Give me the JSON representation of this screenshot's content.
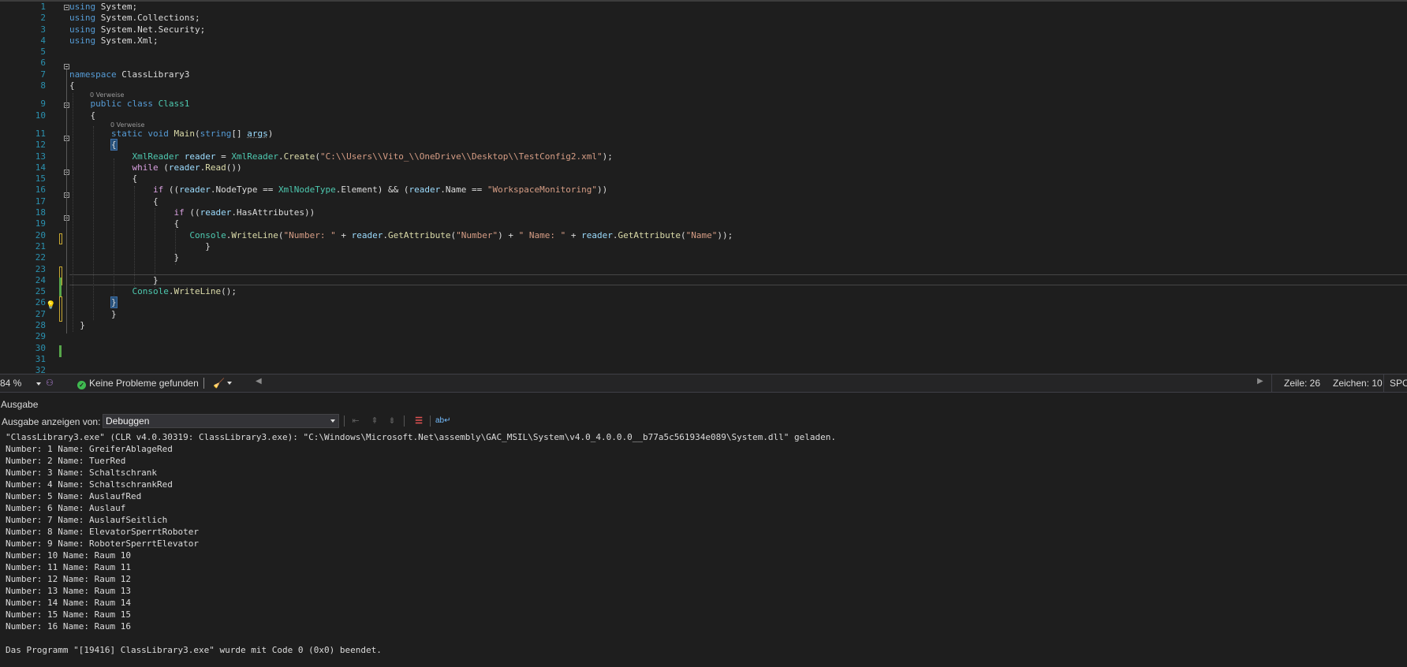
{
  "editor": {
    "line_numbers": [
      "1",
      "2",
      "3",
      "4",
      "5",
      "6",
      "7",
      "8",
      "9",
      "10",
      "11",
      "12",
      "13",
      "14",
      "15",
      "16",
      "17",
      "18",
      "19",
      "20",
      "21",
      "22",
      "23",
      "24",
      "25",
      "26",
      "27",
      "28",
      "29",
      "30",
      "31",
      "32"
    ],
    "references_label": "0 Verweise",
    "lines": {
      "l1_kw": "using",
      "l1_rest": " System;",
      "l2_kw": "using",
      "l2_rest": " System.Collections;",
      "l3_kw": "using",
      "l3_rest": " System.Net.Security;",
      "l4_kw": "using",
      "l4_rest": " System.Xml;",
      "l7_kw": "namespace",
      "l7_rest": " ClassLibrary3",
      "l8": "{",
      "l9_kw1": "public",
      "l9_kw2": "class",
      "l9_name": "Class1",
      "l10": "{",
      "l11_kw1": "static",
      "l11_kw2": "void",
      "l11_fn": "Main",
      "l11_p1": "(",
      "l11_kw3": "string",
      "l11_p2": "[] ",
      "l11_arg": "args",
      "l11_p3": ")",
      "l12": "{",
      "l13_ty": "XmlReader",
      "l13_var": "reader",
      "l13_eq": " = ",
      "l13_ty2": "XmlReader",
      "l13_dot": ".",
      "l13_fn": "Create",
      "l13_p1": "(",
      "l13_str": "\"C:\\\\Users\\\\Vito_\\\\OneDrive\\\\Desktop\\\\TestConfig2.xml\"",
      "l13_p2": ");",
      "l14_kw": "while",
      "l14_p1": " (",
      "l14_var": "reader",
      "l14_dot": ".",
      "l14_fn": "Read",
      "l14_p2": "())",
      "l15": "{",
      "l16_kw": "if",
      "l16_p1": " ((",
      "l16_var": "reader",
      "l16_p2": ".NodeType == ",
      "l16_ty": "XmlNodeType",
      "l16_p3": ".Element) && (",
      "l16_var2": "reader",
      "l16_p4": ".Name == ",
      "l16_str": "\"WorkspaceMonitoring\"",
      "l16_p5": "))",
      "l17": "{",
      "l18_kw": "if",
      "l18_p1": " ((",
      "l18_var": "reader",
      "l18_p2": ".HasAttributes))",
      "l19": "{",
      "l20_ty": "Console",
      "l20_dot": ".",
      "l20_fn": "WriteLine",
      "l20_p1": "(",
      "l20_s1": "\"Number: \"",
      "l20_op1": " + ",
      "l20_v1": "reader",
      "l20_d1": ".",
      "l20_f1": "GetAttribute",
      "l20_p2": "(",
      "l20_s2": "\"Number\"",
      "l20_p3": ") + ",
      "l20_s3": "\" Name: \"",
      "l20_op2": " + ",
      "l20_v2": "reader",
      "l20_d2": ".",
      "l20_f2": "GetAttribute",
      "l20_p4": "(",
      "l20_s4": "\"Name\"",
      "l20_p5": "));",
      "l21": "}",
      "l22": "}",
      "l24": "}",
      "l25_ty": "Console",
      "l25_dot": ".",
      "l25_fn": "WriteLine",
      "l25_p": "();",
      "l26": "}",
      "l27": "}",
      "l28": "}"
    }
  },
  "status_bar": {
    "zoom": "84 %",
    "issues": "Keine Probleme gefunden",
    "line": "Zeile: 26",
    "column": "Zeichen: 10",
    "mode": "SPC"
  },
  "output_panel": {
    "title": "Ausgabe",
    "show_from_label": "Ausgabe anzeigen von:",
    "source_selected": "Debuggen",
    "lines": [
      "\"ClassLibrary3.exe\" (CLR v4.0.30319: ClassLibrary3.exe): \"C:\\Windows\\Microsoft.Net\\assembly\\GAC_MSIL\\System\\v4.0_4.0.0.0__b77a5c561934e089\\System.dll\" geladen.",
      "Number: 1 Name: GreiferAblageRed",
      "Number: 2 Name: TuerRed",
      "Number: 3 Name: Schaltschrank",
      "Number: 4 Name: SchaltschrankRed",
      "Number: 5 Name: AuslaufRed",
      "Number: 6 Name: Auslauf",
      "Number: 7 Name: AuslaufSeitlich",
      "Number: 8 Name: ElevatorSperrtRoboter",
      "Number: 9 Name: RoboterSperrtElevator",
      "Number: 10 Name: Raum 10",
      "Number: 11 Name: Raum 11",
      "Number: 12 Name: Raum 12",
      "Number: 13 Name: Raum 13",
      "Number: 14 Name: Raum 14",
      "Number: 15 Name: Raum 15",
      "Number: 16 Name: Raum 16",
      "",
      "Das Programm \"[19416] ClassLibrary3.exe\" wurde mit Code 0 (0x0) beendet."
    ]
  },
  "colors": {
    "background": "#1e1e1e",
    "keyword": "#569cd6",
    "type": "#4ec9b0",
    "method": "#dcdcaa",
    "string": "#d69d85",
    "variable": "#9cdcfe",
    "line_number": "#2b91af",
    "success": "#3fb950"
  }
}
